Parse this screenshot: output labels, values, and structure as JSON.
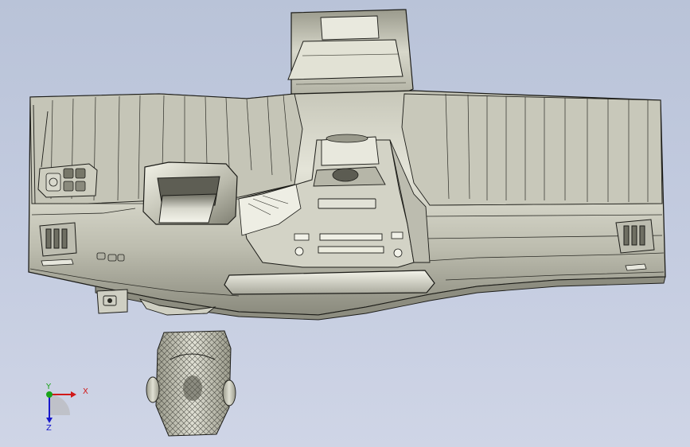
{
  "viewport": {
    "background_top": "#b9c3d8",
    "background_bottom": "#cfd5e6",
    "model": {
      "body_fill": "#cfcfc2",
      "body_shadow": "#8e8e80",
      "highlight": "#f1f1e6",
      "edge_color": "#1c1c18",
      "mesh_color": "#2a2a24"
    }
  },
  "triad": {
    "x_label": "X",
    "y_label": "Y",
    "z_label": "Z",
    "x_color": "#d11818",
    "y_color": "#19a319",
    "z_color": "#1818cc"
  }
}
